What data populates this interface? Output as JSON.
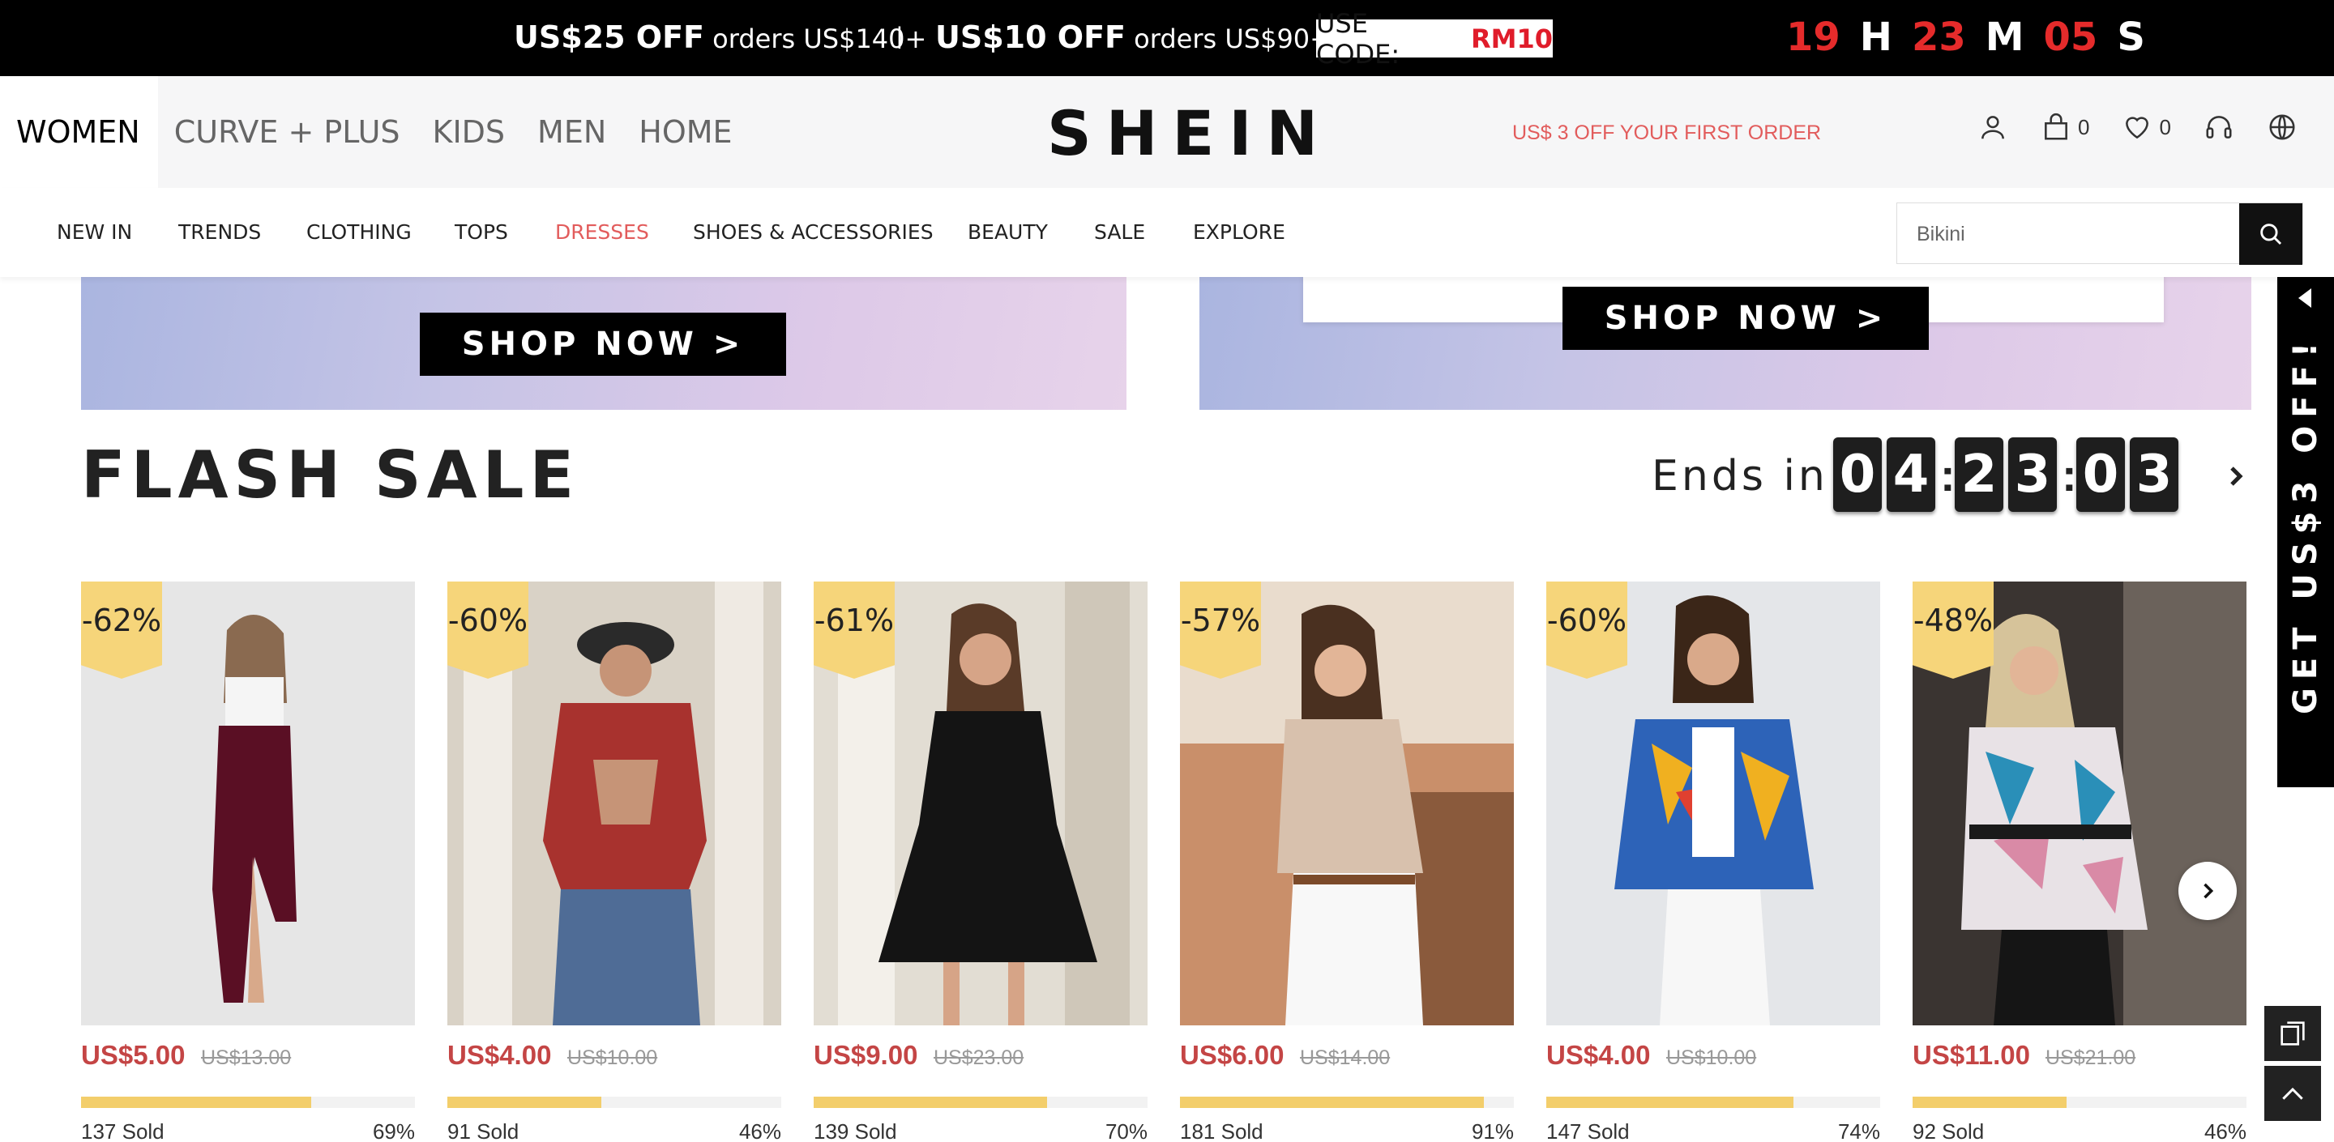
{
  "promo": {
    "deal1_bold": "US$25 OFF",
    "deal1_text": " orders US$140+",
    "separator": "|",
    "deal2_bold": "US$10 OFF",
    "deal2_text": " orders US$90+",
    "code_label": "USE CODE:",
    "code": "RM10",
    "timer": {
      "h": "19",
      "h_unit": "H",
      "m": "23",
      "m_unit": "M",
      "s": "05",
      "s_unit": "S"
    }
  },
  "header": {
    "categories": [
      "WOMEN",
      "CURVE + PLUS",
      "KIDS",
      "MEN",
      "HOME"
    ],
    "logo": "SHEIN",
    "first_order": "US$ 3 OFF YOUR FIRST ORDER",
    "bag_count": "0",
    "wishlist_count": "0"
  },
  "nav": {
    "items": [
      "NEW IN",
      "TRENDS",
      "CLOTHING",
      "TOPS",
      "DRESSES",
      "SHOES & ACCESSORIES",
      "BEAUTY",
      "SALE",
      "EXPLORE"
    ],
    "highlight_color": "#e25c5c"
  },
  "search": {
    "value": "Bikini"
  },
  "banners": {
    "left_button": "SHOP NOW >",
    "right_button": "SHOP NOW >"
  },
  "flash_sale": {
    "title": "FLASH SALE",
    "ends_label": "Ends in",
    "countdown": [
      "0",
      "4",
      "2",
      "3",
      "0",
      "3"
    ],
    "products": [
      {
        "discount": "-62%",
        "price": "US$5.00",
        "old_price": "US$13.00",
        "sold": "137 Sold",
        "percent": "69%",
        "progress": 0.69
      },
      {
        "discount": "-60%",
        "price": "US$4.00",
        "old_price": "US$10.00",
        "sold": "91 Sold",
        "percent": "46%",
        "progress": 0.46
      },
      {
        "discount": "-61%",
        "price": "US$9.00",
        "old_price": "US$23.00",
        "sold": "139 Sold",
        "percent": "70%",
        "progress": 0.7
      },
      {
        "discount": "-57%",
        "price": "US$6.00",
        "old_price": "US$14.00",
        "sold": "181 Sold",
        "percent": "91%",
        "progress": 0.91
      },
      {
        "discount": "-60%",
        "price": "US$4.00",
        "old_price": "US$10.00",
        "sold": "147 Sold",
        "percent": "74%",
        "progress": 0.74
      },
      {
        "discount": "-48%",
        "price": "US$11.00",
        "old_price": "US$21.00",
        "sold": "92 Sold",
        "percent": "46%",
        "progress": 0.46
      }
    ]
  },
  "side_promo": {
    "text": "GET US$3 OFF!"
  },
  "colors": {
    "accent_red": "#c44545",
    "badge_yellow": "#f6d57a",
    "progress_yellow": "#f3ce6b"
  }
}
